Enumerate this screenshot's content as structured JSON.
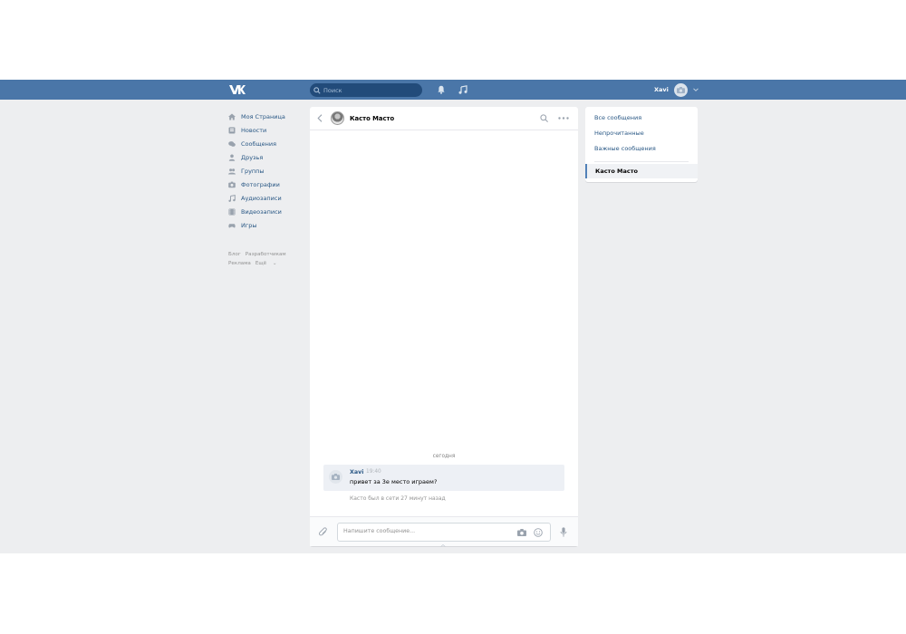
{
  "header": {
    "search_placeholder": "Поиск",
    "user_name": "Xavi"
  },
  "nav": {
    "items": [
      {
        "label": "Моя Страница",
        "icon": "home-icon"
      },
      {
        "label": "Новости",
        "icon": "news-icon"
      },
      {
        "label": "Сообщения",
        "icon": "messages-icon"
      },
      {
        "label": "Друзья",
        "icon": "friends-icon"
      },
      {
        "label": "Группы",
        "icon": "groups-icon"
      },
      {
        "label": "Фотографии",
        "icon": "photos-icon"
      },
      {
        "label": "Аудиозаписи",
        "icon": "audio-icon"
      },
      {
        "label": "Видеозаписи",
        "icon": "video-icon"
      },
      {
        "label": "Игры",
        "icon": "games-icon"
      }
    ],
    "footer": [
      "Блог",
      "Разработчикам",
      "Реклама",
      "Ещё"
    ]
  },
  "chat": {
    "peer_name": "Касто Масто",
    "date_separator": "сегодня",
    "message": {
      "author": "Xavi",
      "time": "19:40",
      "text": "привет за 3е место играем?"
    },
    "peer_status": "Касто был в сети 27 минут назад",
    "composer_placeholder": "Напишите сообщение..."
  },
  "right_panel": {
    "items": [
      "Все сообщения",
      "Непрочитанные",
      "Важные сообщения"
    ],
    "active_dialog": "Касто Масто"
  },
  "colors": {
    "header_bg": "#4a76a8",
    "page_bg": "#edeef0",
    "link": "#2a5885"
  }
}
